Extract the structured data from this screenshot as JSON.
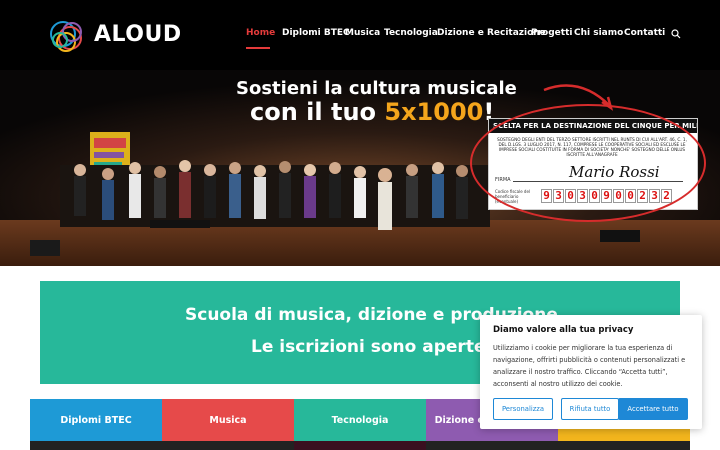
{
  "brand": {
    "name": "ALOUD"
  },
  "nav": {
    "items": [
      {
        "label": "Home",
        "active": true
      },
      {
        "label": "Diplomi BTEC"
      },
      {
        "label": "Musica"
      },
      {
        "label": "Tecnologia"
      },
      {
        "label": "Dizione e Recitazione"
      },
      {
        "label": "Progetti"
      },
      {
        "label": "Chi siamo"
      },
      {
        "label": "Contatti"
      }
    ],
    "search_icon": "search-icon"
  },
  "hero": {
    "headline_line1": "Sostieni la cultura musicale",
    "headline_line2_prefix": "con il tuo ",
    "headline_line2_accent": "5x1000",
    "headline_line2_suffix": "!",
    "card": {
      "header": "SCELTA PER LA DESTINAZIONE DEL CINQUE PER MILLE DE",
      "body": "SOSTEGNO DEGLI ENTI DEL TERZO SETTORE ISCRITTI NEL RUNTS DI CUI ALL'ART. 46, C. 1, DEL D.LGS. 3 LUGLIO 2017, N. 117, COMPRESE LE COOPERATIVE SOCIALI ED ESCLUSE LE IMPRESE SOCIALI COSTITUITE IN FORMA DI SOCIETA' NONCHE' SOSTEGNO DELLE ONLUS ISCRITTE ALL'ANAGRAFE",
      "firma_label": "FIRMA",
      "signature": "Mario Rossi",
      "cf_label": "Codice fiscale del beneficiario (eventuale)",
      "cf_digits": [
        "9",
        "3",
        "0",
        "3",
        "0",
        "9",
        "0",
        "0",
        "2",
        "3",
        "2"
      ]
    },
    "accent_color": "#f4a51c"
  },
  "banner": {
    "line1": "Scuola di musica, dizione e produzione",
    "line2": "Le iscrizioni sono aperte",
    "color": "#27b89a"
  },
  "tiles": [
    {
      "label": "Diplomi BTEC",
      "color": "#1e9ad6"
    },
    {
      "label": "Musica",
      "color": "#e64a4a"
    },
    {
      "label": "Tecnologia",
      "color": "#27b89a"
    },
    {
      "label": "Dizione e Recitazione",
      "color": "#8e5bb0"
    },
    {
      "label": "",
      "color": "#f2b51d"
    }
  ],
  "privacy": {
    "title": "Diamo valore alla tua privacy",
    "text": "Utilizziamo i cookie per migliorare la tua esperienza di navigazione, offrirti pubblicità o contenuti personalizzati e analizzare il nostro traffico. Cliccando “Accetta tutti”, acconsenti al nostro utilizzo dei cookie.",
    "btn_customize": "Personalizza",
    "btn_reject": "Rifiuta tutto",
    "btn_accept": "Accettare tutto",
    "accent_color": "#1e88d6"
  }
}
